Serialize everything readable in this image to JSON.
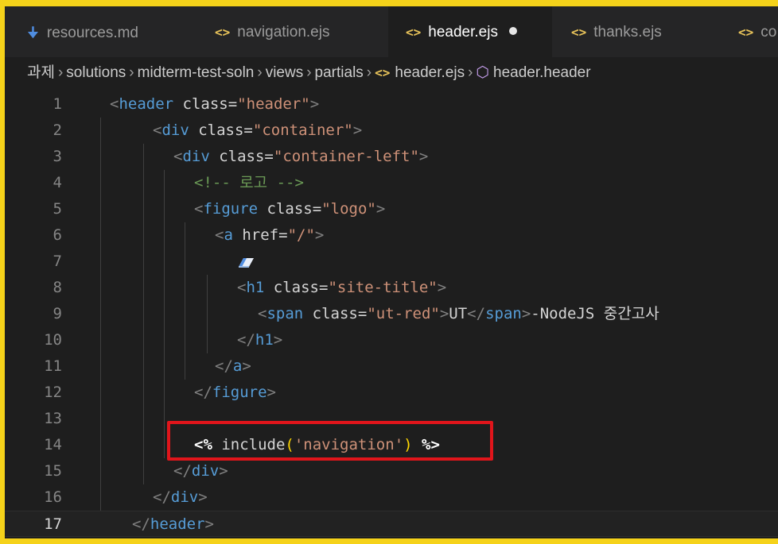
{
  "tabs": [
    {
      "label": "resources.md",
      "icon": "markdown-icon",
      "active": false
    },
    {
      "label": "navigation.ejs",
      "icon": "code-brackets-icon",
      "active": false
    },
    {
      "label": "header.ejs",
      "icon": "code-brackets-icon",
      "active": true,
      "unsaved": true
    },
    {
      "label": "thanks.ejs",
      "icon": "code-brackets-icon",
      "active": false
    },
    {
      "label": "co",
      "icon": "code-brackets-icon",
      "active": false
    }
  ],
  "breadcrumb": [
    "과제",
    "solutions",
    "midterm-test-soln",
    "views",
    "partials",
    "header.ejs",
    "header.header"
  ],
  "editor": {
    "current_line": 17,
    "lines": [
      {
        "n": "1",
        "text": "<header class=\"header\">"
      },
      {
        "n": "2",
        "text": "<div class=\"container\">"
      },
      {
        "n": "3",
        "text": "<div class=\"container-left\">"
      },
      {
        "n": "4",
        "text": "<!-- 로고 -->"
      },
      {
        "n": "5",
        "text": "<figure class=\"logo\">"
      },
      {
        "n": "6",
        "text": "<a href=\"/\">"
      },
      {
        "n": "7",
        "text": ""
      },
      {
        "n": "8",
        "text": "<h1 class=\"site-title\">"
      },
      {
        "n": "9",
        "text": "<span class=\"ut-red\">UT</span>-NodeJS 중간고사"
      },
      {
        "n": "10",
        "text": "</h1>"
      },
      {
        "n": "11",
        "text": "</a>"
      },
      {
        "n": "12",
        "text": "</figure>"
      },
      {
        "n": "13",
        "text": ""
      },
      {
        "n": "14",
        "text": "<% include('navigation') %>"
      },
      {
        "n": "15",
        "text": "</div>"
      },
      {
        "n": "16",
        "text": "</div>"
      },
      {
        "n": "17",
        "text": "</header>"
      }
    ]
  },
  "colors": {
    "border": "#f5d21a",
    "highlight": "#e0151b",
    "editor_bg": "#1e1e1e"
  }
}
